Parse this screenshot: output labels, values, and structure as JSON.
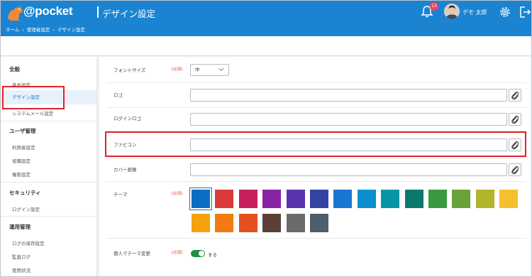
{
  "header": {
    "logo_text": "@pocket",
    "logo_sub": "",
    "app_title": "デザイン設定",
    "breadcrumb": [
      "ホーム",
      "管理者設定",
      "デザイン設定"
    ],
    "breadcrumb_sep": "›",
    "notification_count": "13",
    "user_name": "デモ 太郎"
  },
  "sidebar": {
    "sections": [
      {
        "title": "全般",
        "items": [
          "基本設定",
          "デザイン設定",
          "システムメール設定"
        ]
      },
      {
        "title": "ユーザ管理",
        "items": [
          "利用者設定",
          "役職設定",
          "権限設定"
        ]
      },
      {
        "title": "セキュリティ",
        "items": [
          "ログイン設定"
        ]
      },
      {
        "title": "運用管理",
        "items": [
          "ログの保存設定",
          "監査ログ",
          "使用状況"
        ]
      }
    ],
    "active_item": "デザイン設定"
  },
  "form": {
    "required_label": "[必須]",
    "font_size": {
      "label": "フォントサイズ",
      "value": "中"
    },
    "logo": {
      "label": "ロゴ",
      "value": ""
    },
    "login_logo": {
      "label": "ログインロゴ",
      "value": ""
    },
    "favicon": {
      "label": "ファビコン",
      "value": ""
    },
    "cover_image": {
      "label": "カバー画像",
      "value": ""
    },
    "theme": {
      "label": "テーマ",
      "selected_index": 0,
      "colors": [
        "#0a6fc2",
        "#d93a3a",
        "#c8205e",
        "#8a24a6",
        "#5a33b0",
        "#3444a3",
        "#1976d2",
        "#0b8fd0",
        "#0796a6",
        "#0a7a6c",
        "#3a9a3f",
        "#6aa23a",
        "#b2b42c",
        "#f5c02e",
        "#f5a20c",
        "#f27a10",
        "#e4501f",
        "#5b4036",
        "#6b6b6b",
        "#4e5f6b"
      ]
    },
    "personal_theme": {
      "label": "個人でテーマ変更",
      "toggle_label": "する",
      "enabled": true
    }
  },
  "colors": {
    "header_bg": "#1a84d3",
    "highlight": "#e0222a",
    "active_bg": "#e8f1fb",
    "toggle_on": "#1e8f3e"
  }
}
